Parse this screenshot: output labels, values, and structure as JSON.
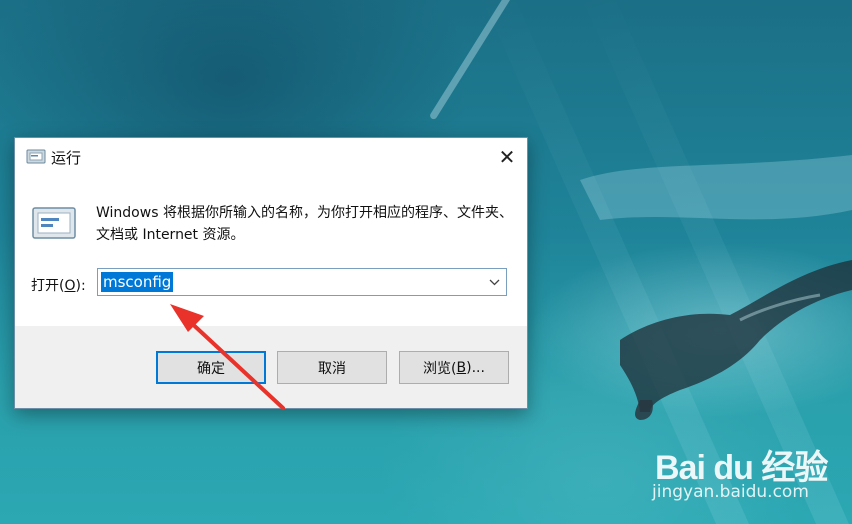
{
  "dialog": {
    "title": "运行",
    "close_icon": "close-icon",
    "description": "Windows 将根据你所输入的名称，为你打开相应的程序、文件夹、文档或 Internet 资源。",
    "open_label_prefix": "打开(",
    "open_label_key": "O",
    "open_label_suffix": "):",
    "input_value": "msconfig",
    "ok_label": "确定",
    "cancel_label": "取消",
    "browse_prefix": "浏览(",
    "browse_key": "B",
    "browse_suffix": ")..."
  },
  "watermark": {
    "logo": "Bai du 经验",
    "url": "jingyan.baidu.com"
  },
  "colors": {
    "accent": "#0078d7",
    "arrow": "#e8322a"
  }
}
